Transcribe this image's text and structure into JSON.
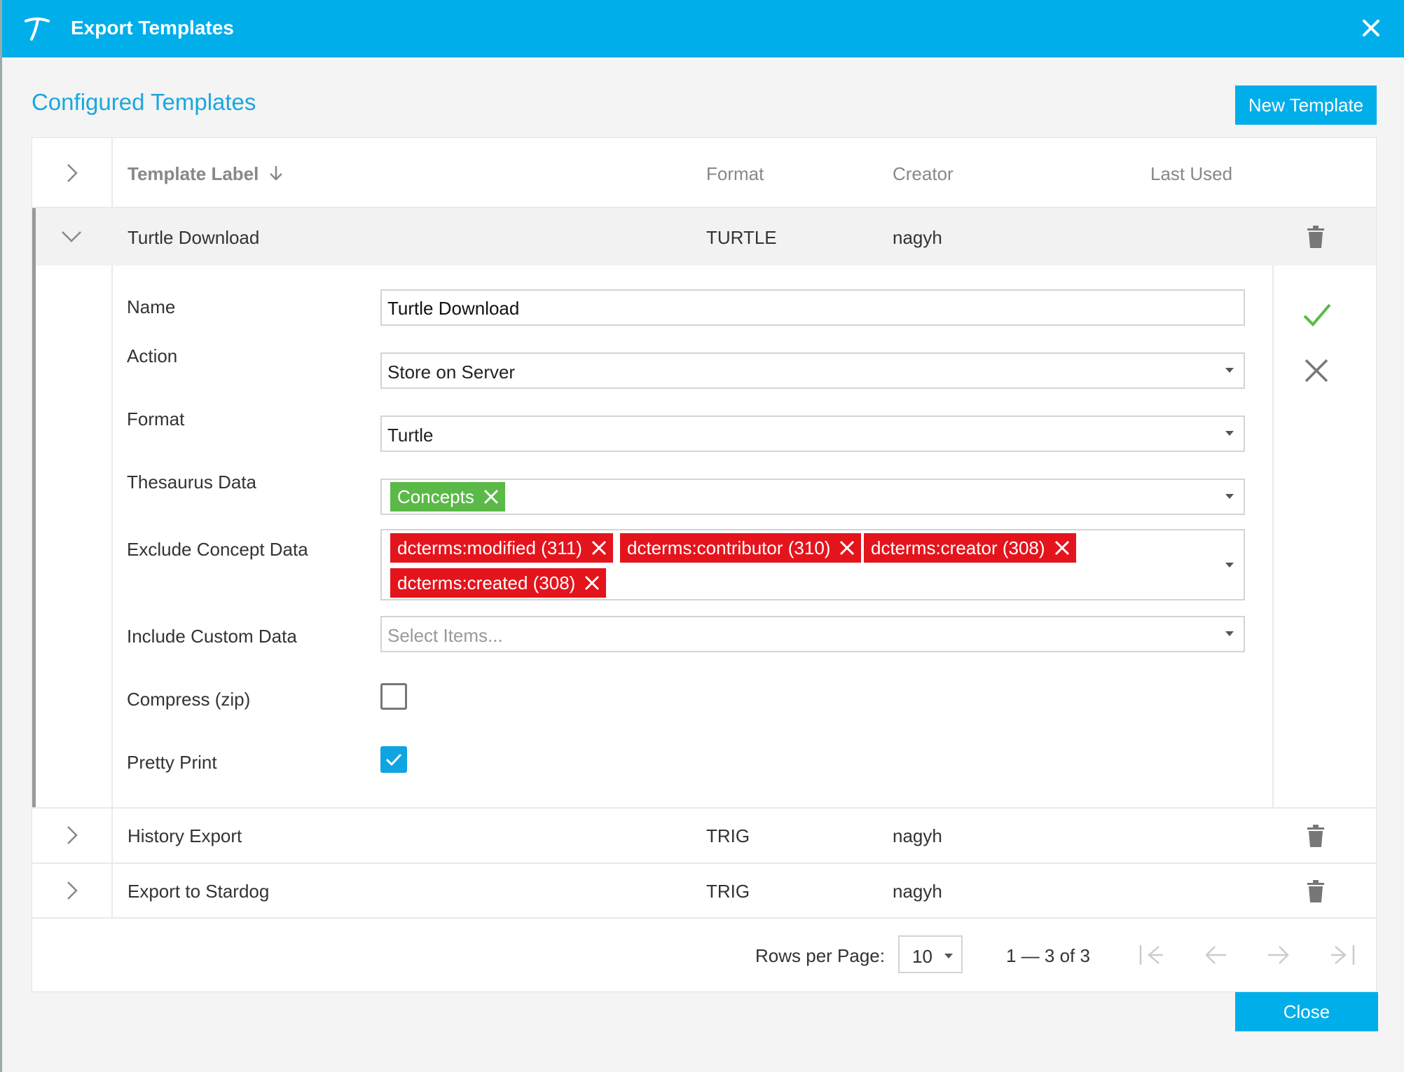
{
  "window": {
    "title": "Export Templates"
  },
  "section": {
    "title": "Configured Templates",
    "new_button": "New Template"
  },
  "table": {
    "columns": {
      "label": "Template Label",
      "format": "Format",
      "creator": "Creator",
      "last_used": "Last Used"
    },
    "rows": [
      {
        "label": "Turtle Download",
        "format": "TURTLE",
        "creator": "nagyh",
        "expanded": true
      },
      {
        "label": "History Export",
        "format": "TRIG",
        "creator": "nagyh",
        "expanded": false
      },
      {
        "label": "Export to Stardog",
        "format": "TRIG",
        "creator": "nagyh",
        "expanded": false
      }
    ]
  },
  "form": {
    "name_label": "Name",
    "name_value": "Turtle Download",
    "action_label": "Action",
    "action_value": "Store on Server",
    "format_label": "Format",
    "format_value": "Turtle",
    "thesaurus_label": "Thesaurus Data",
    "thesaurus_chips": [
      "Concepts"
    ],
    "exclude_label": "Exclude Concept Data",
    "exclude_chips": [
      "dcterms:modified (311)",
      "dcterms:contributor (310)",
      "dcterms:creator (308)",
      "dcterms:created (308)"
    ],
    "custom_label": "Include Custom Data",
    "custom_placeholder": "Select Items...",
    "compress_label": "Compress (zip)",
    "compress_checked": false,
    "pretty_label": "Pretty Print",
    "pretty_checked": true
  },
  "pager": {
    "rows_label": "Rows per Page:",
    "rows_value": "10",
    "range": "1 — 3 of 3"
  },
  "footer": {
    "close_button": "Close"
  },
  "colors": {
    "accent": "#00aeea",
    "chip_include": "#5ab947",
    "chip_exclude": "#e4141c",
    "confirm": "#5ab947"
  }
}
